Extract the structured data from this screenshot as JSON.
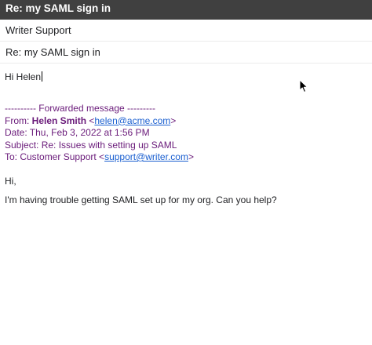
{
  "window": {
    "title": "Re: my SAML sign in"
  },
  "header": {
    "to": "Writer Support",
    "subject": "Re: my SAML sign in"
  },
  "compose": {
    "greeting": "Hi Helen",
    "forwarded": {
      "divider": "---------- Forwarded message ---------",
      "from_label": "From: ",
      "from_name": "Helen Smith",
      "from_open": " <",
      "from_email": "helen@acme.com",
      "from_close": ">",
      "date": "Date: Thu, Feb 3, 2022 at 1:56 PM",
      "subject": "Subject: Re: Issues with setting up SAML",
      "to_label": "To: Customer Support <",
      "to_email": "support@writer.com",
      "to_close": ">"
    },
    "message": {
      "salutation": "Hi,",
      "body": "I'm having trouble getting SAML set up for my org. Can you help?"
    }
  },
  "colors": {
    "titlebar": "#404040",
    "forwarded_text": "#6a1b7a",
    "link": "#1a5fd0"
  },
  "icons": {
    "pointer": "mouse-pointer-icon"
  }
}
